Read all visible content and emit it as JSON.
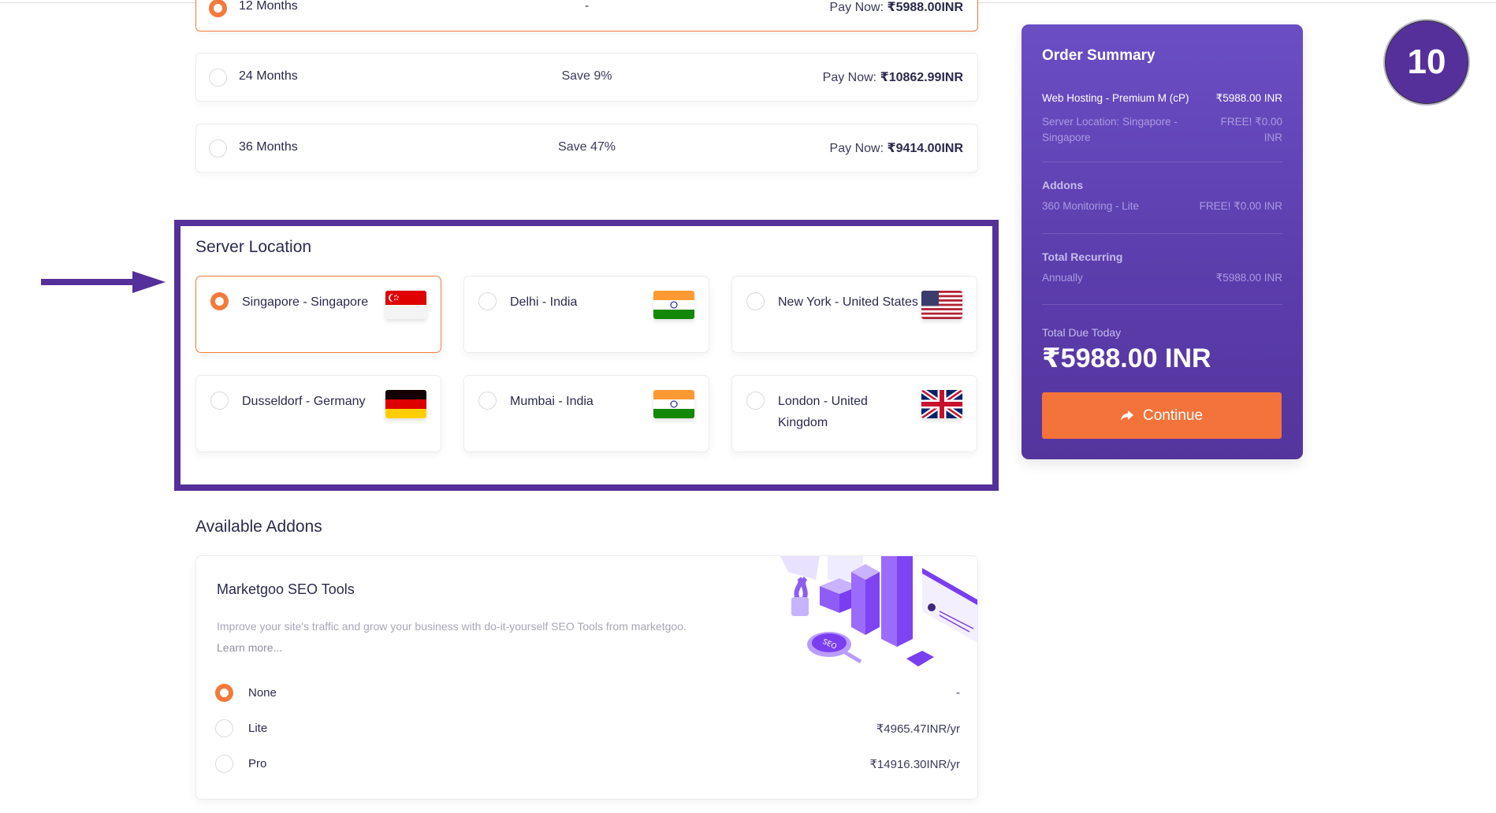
{
  "billing_cycles": [
    {
      "term": "12 Months",
      "savings": "-",
      "pay_label": "Pay Now:",
      "price": "₹5988.00INR",
      "selected": true
    },
    {
      "term": "24 Months",
      "savings": "Save 9%",
      "pay_label": "Pay Now:",
      "price": "₹10862.99INR",
      "selected": false
    },
    {
      "term": "36 Months",
      "savings": "Save 47%",
      "pay_label": "Pay Now:",
      "price": "₹9414.00INR",
      "selected": false
    }
  ],
  "server_location": {
    "title": "Server Location",
    "options": [
      {
        "name": "Singapore - Singapore",
        "flag": "singapore-flag-icon",
        "selected": true
      },
      {
        "name": "Delhi - India",
        "flag": "india-flag-icon",
        "selected": false
      },
      {
        "name": "New York - United States",
        "flag": "usa-flag-icon",
        "selected": false
      },
      {
        "name": "Dusseldorf - Germany",
        "flag": "germany-flag-icon",
        "selected": false
      },
      {
        "name": "Mumbai - India",
        "flag": "india-flag-icon",
        "selected": false
      },
      {
        "name": "London - United Kingdom",
        "flag": "uk-flag-icon",
        "selected": false
      }
    ]
  },
  "addons": {
    "title": "Available Addons",
    "card": {
      "title": "Marketgoo SEO Tools",
      "description": "Improve your site's traffic and grow your business with do-it-yourself SEO Tools from marketgoo.",
      "learn_more": "Learn more...",
      "illustration": "seo-analytics-illustration",
      "options": [
        {
          "name": "None",
          "price": "-",
          "selected": true
        },
        {
          "name": "Lite",
          "price": "₹4965.47INR/yr",
          "selected": false
        },
        {
          "name": "Pro",
          "price": "₹14916.30INR/yr",
          "selected": false
        }
      ]
    }
  },
  "order_summary": {
    "title": "Order Summary",
    "product": {
      "label": "Web Hosting - Premium M (cP)",
      "price": "₹5988.00 INR"
    },
    "server_location": {
      "label": "Server Location: Singapore - Singapore",
      "price": "FREE! ₹0.00 INR"
    },
    "addons_heading": "Addons",
    "addon": {
      "label": "360 Monitoring - Lite",
      "price": "FREE! ₹0.00 INR"
    },
    "recurring_heading": "Total Recurring",
    "recurring": {
      "label": "Annually",
      "price": "₹5988.00 INR"
    },
    "due_label": "Total Due Today",
    "due_amount": "₹5988.00 INR",
    "continue_label": "Continue"
  },
  "annotation": {
    "step_number": "10",
    "arrow": "pointing-right-arrow"
  },
  "colors": {
    "accent_orange": "#f47a3c",
    "brand_purple": "#55309a",
    "summary_purple": "#6a4ec4"
  }
}
